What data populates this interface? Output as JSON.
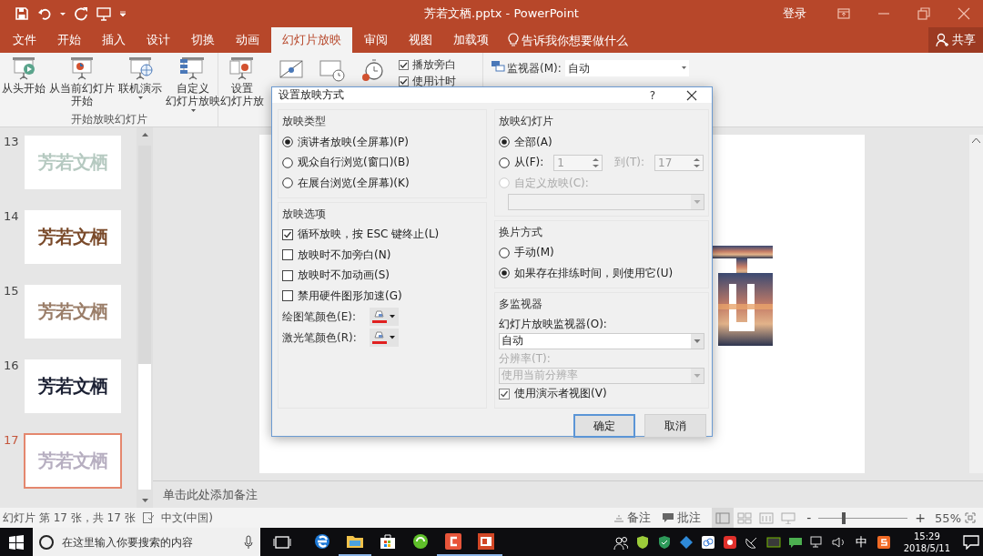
{
  "window": {
    "title": "芳若文栖.pptx - PowerPoint",
    "sign_in": "登录"
  },
  "tabs": [
    {
      "label": "文件",
      "selected": false
    },
    {
      "label": "开始",
      "selected": false
    },
    {
      "label": "插入",
      "selected": false
    },
    {
      "label": "设计",
      "selected": false
    },
    {
      "label": "切换",
      "selected": false
    },
    {
      "label": "动画",
      "selected": false
    },
    {
      "label": "幻灯片放映",
      "selected": true
    },
    {
      "label": "审阅",
      "selected": false
    },
    {
      "label": "视图",
      "selected": false
    },
    {
      "label": "加载项",
      "selected": false
    }
  ],
  "tell_me": {
    "placeholder": "告诉我你想要做什么"
  },
  "share_button": {
    "label": "共享"
  },
  "ribbon": {
    "group_label": "开始放映幻灯片",
    "buttons": [
      {
        "lines": [
          "从头开始"
        ],
        "kind": "play",
        "dropdown": false
      },
      {
        "lines": [
          "从当前幻灯片",
          "开始"
        ],
        "kind": "current",
        "dropdown": false
      },
      {
        "lines": [
          "联机演示"
        ],
        "kind": "online",
        "dropdown": true
      },
      {
        "lines": [
          "自定义",
          "幻灯片放映"
        ],
        "kind": "custom",
        "dropdown": true
      },
      {
        "lines": [
          "设置",
          "幻灯片放"
        ],
        "kind": "setup",
        "dropdown": false
      }
    ],
    "checkboxes": [
      {
        "label": "播放旁白",
        "checked": true
      },
      {
        "label": "使用计时",
        "checked": true
      }
    ],
    "monitor": {
      "label": "监视器(M):",
      "value": "自动"
    }
  },
  "thumbnails": [
    {
      "number": "13",
      "text": "芳若文栖",
      "kind": "pale",
      "selected": false
    },
    {
      "number": "14",
      "text": "芳若文栖",
      "kind": "warm",
      "selected": false
    },
    {
      "number": "15",
      "text": "芳若文栖",
      "kind": "sky",
      "selected": false
    },
    {
      "number": "16",
      "text": "芳若文栖",
      "kind": "dark",
      "selected": false
    },
    {
      "number": "17",
      "text": "芳若文栖",
      "kind": "pastel",
      "selected": true
    }
  ],
  "notes_placeholder": "单击此处添加备注",
  "dialog": {
    "title": "设置放映方式",
    "help": "?",
    "show_type": {
      "heading": "放映类型",
      "options": [
        {
          "label": "演讲者放映(全屏幕)(P)",
          "selected": true
        },
        {
          "label": "观众自行浏览(窗口)(B)",
          "selected": false
        },
        {
          "label": "在展台浏览(全屏幕)(K)",
          "selected": false
        }
      ]
    },
    "show_options": {
      "heading": "放映选项",
      "checkboxes": [
        {
          "label": "循环放映，按 ESC 键终止(L)",
          "checked": true
        },
        {
          "label": "放映时不加旁白(N)",
          "checked": false
        },
        {
          "label": "放映时不加动画(S)",
          "checked": false
        },
        {
          "label": "禁用硬件图形加速(G)",
          "checked": false
        }
      ],
      "pens": [
        {
          "label": "绘图笔颜色(E):",
          "color": "#e02020"
        },
        {
          "label": "激光笔颜色(R):",
          "color": "#e02020"
        }
      ]
    },
    "slides": {
      "heading": "放映幻灯片",
      "options": [
        {
          "label": "全部(A)",
          "selected": true,
          "disabled": false
        },
        {
          "label": "从(F):",
          "selected": false,
          "disabled": false
        },
        {
          "label": "自定义放映(C):",
          "selected": false,
          "disabled": true
        }
      ],
      "from": "1",
      "to_label": "到(T):",
      "to": "17"
    },
    "advance": {
      "heading": "换片方式",
      "options": [
        {
          "label": "手动(M)",
          "selected": false
        },
        {
          "label": "如果存在排练时间，则使用它(U)",
          "selected": true
        }
      ]
    },
    "monitors": {
      "heading": "多监视器",
      "monitor_label": "幻灯片放映监视器(O):",
      "monitor_value": "自动",
      "resolution_label": "分辨率(T):",
      "resolution_value": "使用当前分辨率",
      "resolution_disabled": true,
      "presenter_view": {
        "label": "使用演示者视图(V)",
        "checked": true
      }
    },
    "buttons": [
      {
        "label": "确定",
        "kind": "default"
      },
      {
        "label": "取消",
        "kind": "normal"
      }
    ]
  },
  "status_bar": {
    "slide_info": "幻灯片 第 17 张，共 17 张",
    "language": "中文(中国)",
    "notes": "备注",
    "comments": "批注",
    "views": [
      {
        "kind": "normal",
        "selected": true
      },
      {
        "kind": "sorter",
        "selected": false
      },
      {
        "kind": "reading",
        "selected": false
      },
      {
        "kind": "slideshow",
        "selected": false
      }
    ],
    "zoom_out": "-",
    "zoom_in": "+",
    "zoom": {
      "level": 0.28
    },
    "zoom_text": "55%"
  },
  "taskbar": {
    "search_placeholder": "在这里输入你要搜索的内容",
    "apps": [
      {
        "kind": "browser",
        "running": false
      },
      {
        "kind": "folder",
        "running": true
      },
      {
        "kind": "store",
        "running": false
      },
      {
        "kind": "green",
        "running": false
      },
      {
        "kind": "red",
        "running": true
      },
      {
        "kind": "presentation",
        "running": true
      }
    ],
    "ime": "中",
    "time": "15:29",
    "date": "2018/5/11"
  }
}
